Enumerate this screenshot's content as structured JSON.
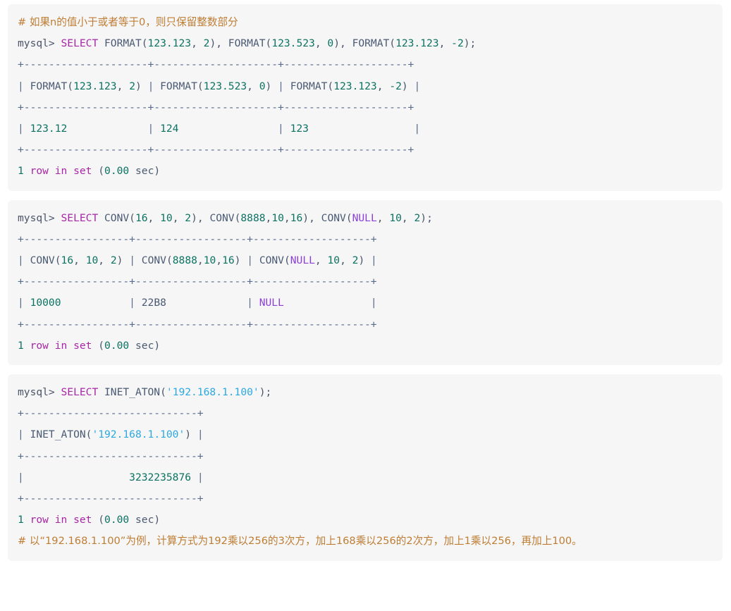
{
  "page": {
    "title": "MySQL numeric function examples",
    "background": "#ffffff",
    "code_block_background": "#f6f6f7"
  },
  "colors": {
    "comment": "#bf7d33",
    "keyword": "#a626a4",
    "number": "#0b7261",
    "string": "#2ca8e0",
    "null": "#8b3fd6",
    "identifier": "#4a5a72",
    "punctuation": "#4a5568",
    "table_rule": "#5a6c8c"
  },
  "blocks": [
    {
      "id": "format-block",
      "comment": "# 如果n的值小于或者等于0，则只保留整数部分",
      "prompt": "mysql> ",
      "keyword": "SELECT",
      "query_tail": " FORMAT(123.123, 2), FORMAT(123.523, 0), FORMAT(123.123, -2);",
      "sep": "+--------------------+--------------------+--------------------+",
      "header": "| FORMAT(123.123, 2) | FORMAT(123.523, 0) | FORMAT(123.123, -2) |",
      "row": "| 123.12             | 124                | 123                 |",
      "row_values": [
        "123.12",
        "124",
        "123"
      ],
      "status_count": "1",
      "status_words": "row in set",
      "status_time": "0.00",
      "status_unit": "sec"
    },
    {
      "id": "conv-block",
      "comment": "",
      "prompt": "mysql> ",
      "keyword": "SELECT",
      "query_tail": " CONV(16, 10, 2), CONV(8888,10,16), CONV(NULL, 10, 2);",
      "sep": "+-----------------+------------------+-------------------+",
      "header": "| CONV(16, 10, 2) | CONV(8888,10,16) | CONV(NULL, 10, 2) |",
      "row": "| 10000           | 22B8             | NULL              |",
      "row_values": [
        "10000",
        "22B8",
        "NULL"
      ],
      "status_count": "1",
      "status_words": "row in set",
      "status_time": "0.00",
      "status_unit": "sec"
    },
    {
      "id": "inet-aton-block",
      "comment": "",
      "prompt": "mysql> ",
      "keyword": "SELECT",
      "query_tail": " INET_ATON('192.168.1.100');",
      "sep": "+----------------------------+",
      "header": "| INET_ATON('192.168.1.100') |",
      "row": "|                 3232235876 |",
      "row_values": [
        "3232235876"
      ],
      "status_count": "1",
      "status_words": "row in set",
      "status_time": "0.00",
      "status_unit": "sec",
      "trailing_comment": "# 以“192.168.1.100”为例，计算方式为192乘以256的3次方，加上168乘以256的2次方，加上1乘以256，再加上100。"
    }
  ]
}
